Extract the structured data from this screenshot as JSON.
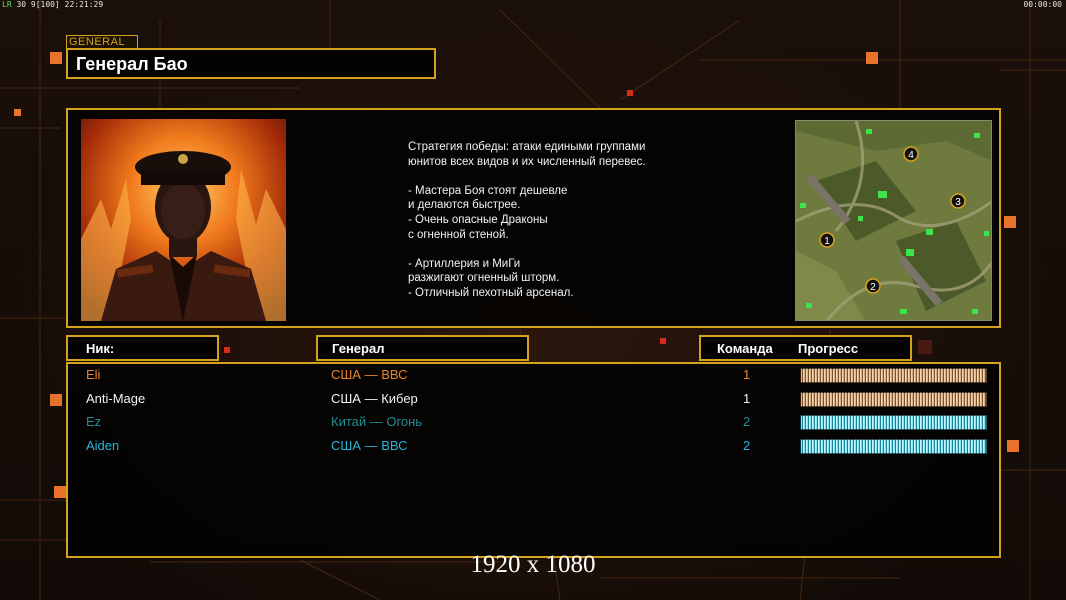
{
  "hud": {
    "fps_prefix": "LR",
    "fps_text": "30 9[100] 22:21:29",
    "timer": "00:00:00"
  },
  "general_tag": "GENERAL",
  "title": "Генерал Бао",
  "description": [
    "Стратегия победы: атаки едиными группами",
    "юнитов всех видов и их численный перевес.",
    "",
    "- Мастера Боя стоят дешевле",
    "и делаются быстрее.",
    "- Очень опасные Драконы",
    "с огненной стеной.",
    "",
    "- Артиллерия и МиГи",
    "разжигают огненный шторм.",
    "- Отличный пехотный арсенал."
  ],
  "minimap": {
    "start_positions": [
      "1",
      "2",
      "3",
      "4"
    ]
  },
  "headers": {
    "nick": "Ник:",
    "general": "Генерал",
    "team": "Команда",
    "progress": "Прогресс"
  },
  "players": [
    {
      "nick": "Eli",
      "general": "США — ВВС",
      "team": "1",
      "color": "#e8842e",
      "progress_color": "orange"
    },
    {
      "nick": "Anti-Mage",
      "general": "США — Кибер",
      "team": "1",
      "color": "#f2f2f2",
      "progress_color": "orange"
    },
    {
      "nick": "Ez",
      "general": "Китай — Огонь",
      "team": "2",
      "color": "#1f8f97",
      "progress_color": "cyan"
    },
    {
      "nick": "Aiden",
      "general": "США — ВВС",
      "team": "2",
      "color": "#27b4d8",
      "progress_color": "cyan"
    }
  ],
  "resolution_label": "1920 x 1080",
  "colors": {
    "accent": "#d4a21c",
    "orange": "#e8732a",
    "background": "#120c08"
  }
}
